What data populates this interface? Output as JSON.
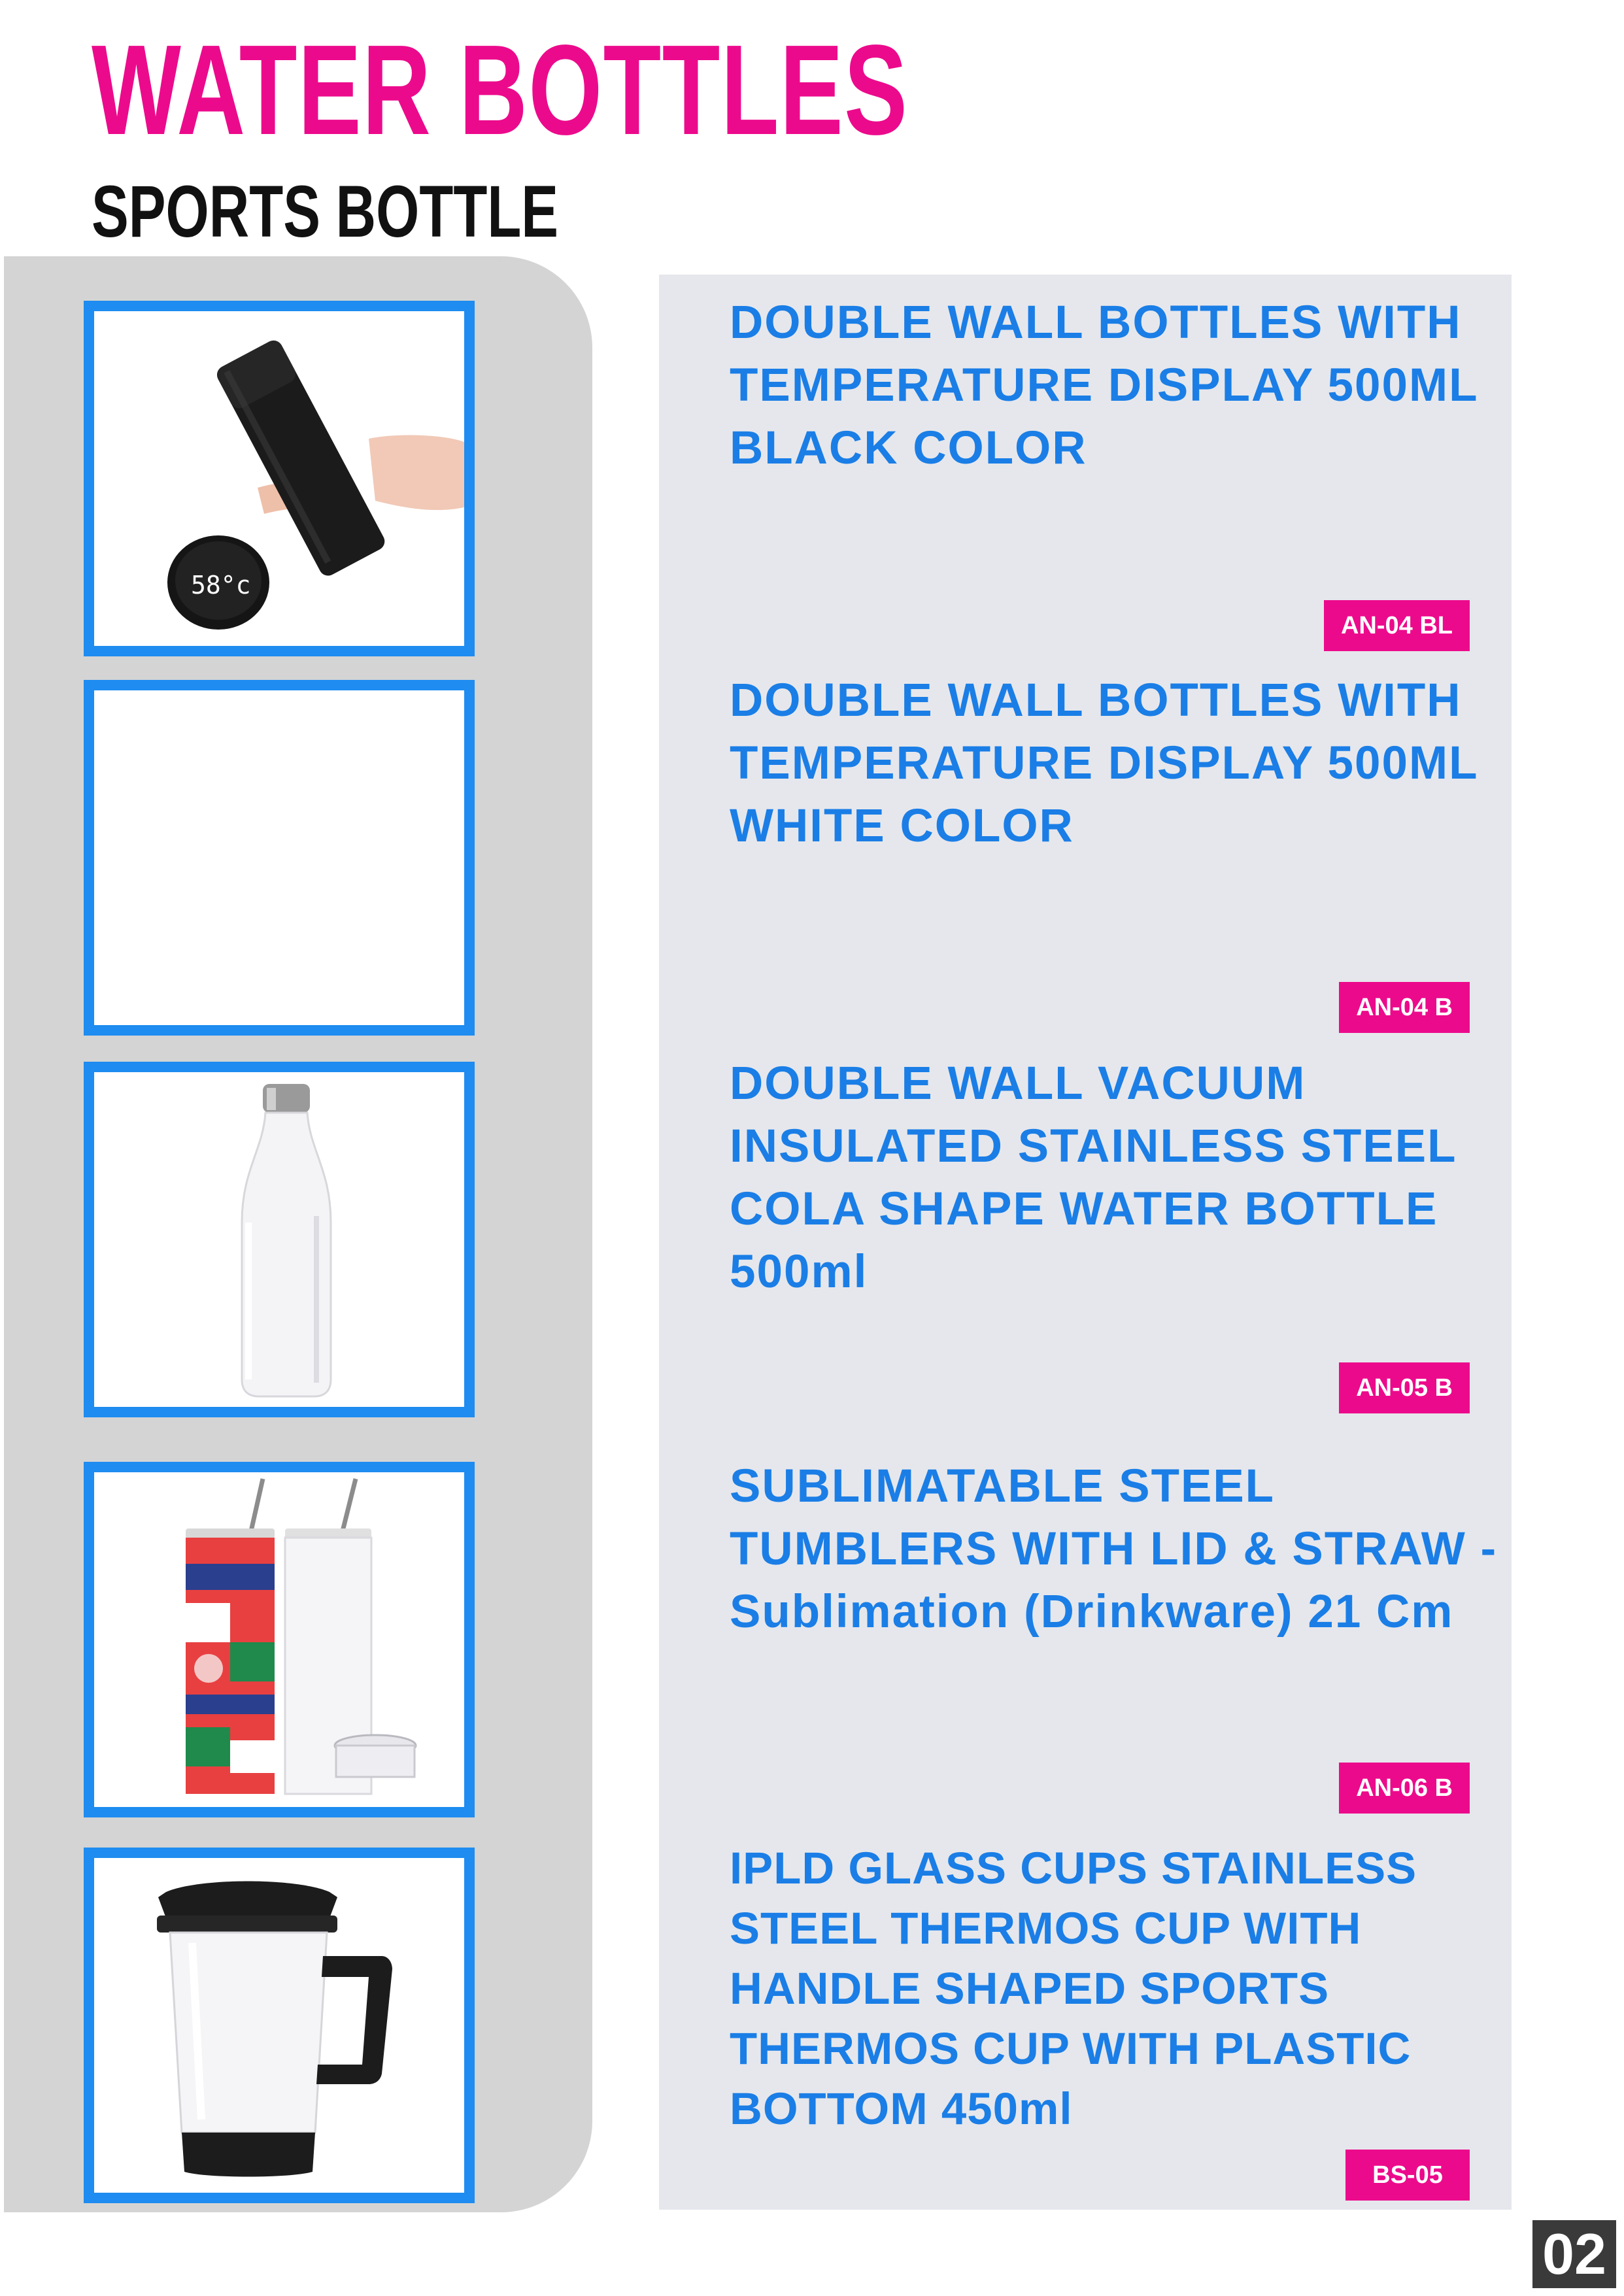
{
  "header": {
    "title": "WATER BOTTLES",
    "subtitle": "SPORTS BOTTLE"
  },
  "products": [
    {
      "title": "DOUBLE WALL BOTTLES WITH TEMPERATURE DISPLAY 500ML BLACK COLOR",
      "code": "AN-04 BL",
      "display_reading": "58°c"
    },
    {
      "title": "DOUBLE WALL BOTTLES WITH TEMPERATURE DISPLAY 500ML WHITE COLOR",
      "code": "AN-04 B"
    },
    {
      "title": "DOUBLE WALL VACUUM INSULATED STAINLESS STEEL COLA SHAPE WATER BOTTLE 500ml",
      "code": "AN-05 B"
    },
    {
      "title": "SUBLIMATABLE STEEL TUMBLERS WITH LID & STRAW - Sublimation (Drinkware) 21 Cm",
      "code": "AN-06 B"
    },
    {
      "title": "IPLD GLASS CUPS STAINLESS STEEL THERMOS CUP WITH HANDLE SHAPED SPORTS THERMOS CUP WITH PLASTIC BOTTOM 450ml",
      "code": "BS-05"
    }
  ],
  "page_number": "02",
  "colors": {
    "accent_pink": "#ec0a8c",
    "title_blue": "#1a7ee6",
    "frame_blue": "#1e8cf0",
    "panel_grey": "#d4d4d4",
    "card_grey": "#e6e7ec"
  }
}
